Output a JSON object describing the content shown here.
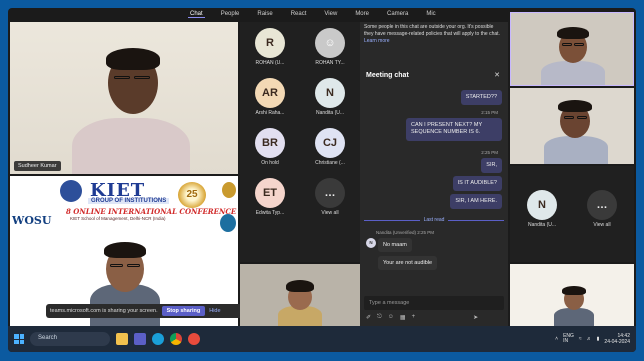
{
  "toolbar": {
    "tabs": [
      {
        "label": "Chat",
        "active": true
      },
      {
        "label": "People"
      },
      {
        "label": "Raise"
      },
      {
        "label": "React"
      },
      {
        "label": "View"
      },
      {
        "label": "More"
      },
      {
        "label": "Camera"
      },
      {
        "label": "Mic"
      }
    ]
  },
  "main_video": {
    "name": "Sudheer Kumar"
  },
  "slide": {
    "logo": "KIET",
    "group": "GROUP OF INSTITUTIONS",
    "conference": "8 ONLINE INTERNATIONAL CONFERENCE",
    "sub": "KIET School of Management, Delhi-NCR (India)",
    "osu": "WOSU",
    "badge": "25"
  },
  "share_bar": {
    "text": "teams.microsoft.com is sharing your screen.",
    "stop": "Stop sharing",
    "hide": "Hide"
  },
  "participants": [
    {
      "initials": "R",
      "label": "ROHAN (U...",
      "color": "#e8e6d5"
    },
    {
      "initials": "",
      "label": "ROHAN TY...",
      "color": "#c9c9c9"
    },
    {
      "initials": "AR",
      "label": "Arshi Raha...",
      "color": "#f3d9b5"
    },
    {
      "initials": "N",
      "label": "Nandita (U...",
      "color": "#dfe8ea"
    },
    {
      "initials": "BR",
      "label": "On hold",
      "color": "#e2dff0"
    },
    {
      "initials": "CJ",
      "label": "Christiane (...",
      "color": "#dfe3f3"
    },
    {
      "initials": "ET",
      "label": "Edwita Typ...",
      "color": "#f5d5cc"
    },
    {
      "initials": "…",
      "label": "View all",
      "color": "#3a3a3a"
    }
  ],
  "chat": {
    "notice": "Some people in this chat are outside your org. It's possible they have message-related policies that will apply to the chat.",
    "learn_more": "Learn more",
    "title": "Meeting chat",
    "messages": [
      {
        "text": "STARTED??"
      },
      {
        "time": "2:15 PM"
      },
      {
        "text": "CAN I PRESENT NEXT? MY SEQUENCE NUMBER IS 6."
      },
      {
        "time": "2:25 PM"
      },
      {
        "text": "SIR,"
      },
      {
        "text": "IS IT AUDIBLE?"
      },
      {
        "text": "SIR, I AM HERE."
      }
    ],
    "last_read": "Last read",
    "sender": "Nandita (Unverified)  2:25 PM",
    "sender_initial": "N",
    "incoming": [
      "No maam",
      "Your are not audible"
    ],
    "compose_placeholder": "Type a message"
  },
  "right_grid": [
    {
      "initials": "N",
      "label": "Nandita (U..."
    },
    {
      "initials": "…",
      "label": "View all"
    }
  ],
  "taskbar": {
    "search": "Search",
    "lang": "ENG\nIN",
    "time": "14:42",
    "date": "24-04-2024"
  }
}
